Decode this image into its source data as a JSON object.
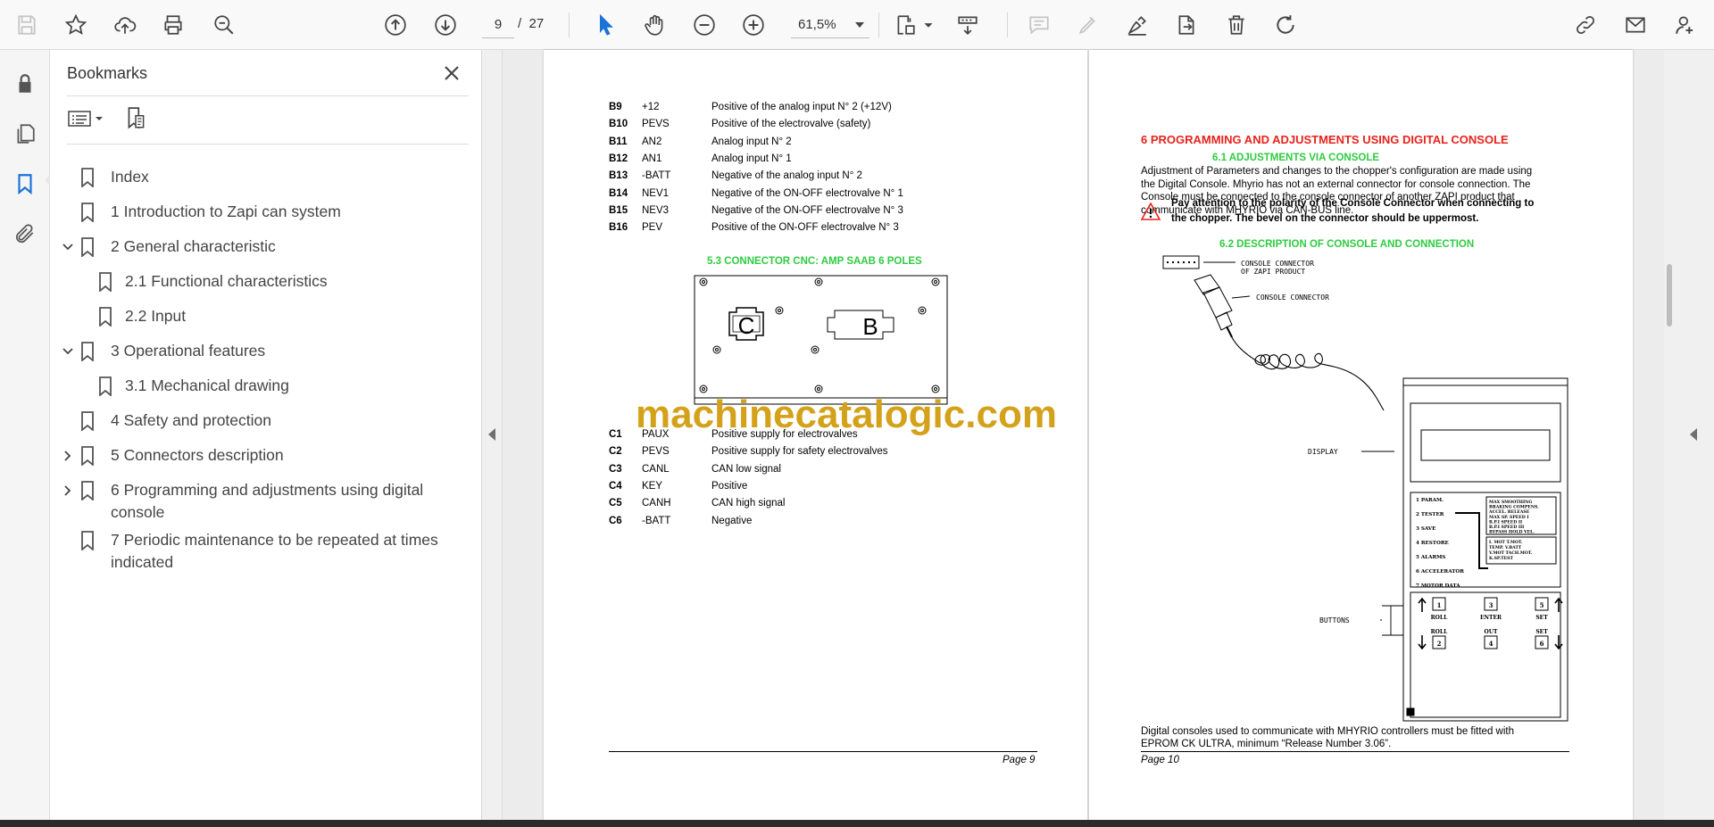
{
  "toolbar": {
    "page_current": "9",
    "page_separator": "/",
    "page_total": "27",
    "zoom": "61,5%",
    "icons": [
      "save-icon",
      "star-icon",
      "cloud-upload-icon",
      "print-icon",
      "zoom-search-icon",
      "page-up-icon",
      "page-down-icon",
      "select-cursor-icon",
      "hand-icon",
      "zoom-out-icon",
      "zoom-in-icon",
      "fit-page-icon",
      "scroll-mode-icon",
      "comment-icon",
      "highlight-icon",
      "sign-icon",
      "export-icon",
      "delete-icon",
      "rotate-icon",
      "share-link-icon",
      "email-icon",
      "add-user-icon"
    ]
  },
  "rail": {
    "icons": [
      "lock-icon",
      "pages-icon",
      "bookmark-icon",
      "attachment-icon"
    ]
  },
  "bookmarks": {
    "title": "Bookmarks",
    "items": [
      {
        "label": "Index"
      },
      {
        "label": "1 Introduction to Zapi can system"
      },
      {
        "label": "2 General characteristic"
      },
      {
        "label": "2.1 Functional characteristics"
      },
      {
        "label": "2.2 Input"
      },
      {
        "label": "3 Operational features"
      },
      {
        "label": "3.1 Mechanical drawing"
      },
      {
        "label": "4 Safety and protection"
      },
      {
        "label": "5 Connectors description"
      },
      {
        "label": "6 Programming and adjustments using digital",
        "label2": "console"
      },
      {
        "label": "7 Periodic maintenance to be repeated at times",
        "label2": "indicated"
      }
    ]
  },
  "page9": {
    "rows_b": [
      {
        "pin": "B9",
        "sig": "+12",
        "desc": "Positive of the analog input N° 2 (+12V)"
      },
      {
        "pin": "B10",
        "sig": "PEVS",
        "desc": "Positive of the electrovalve (safety)"
      },
      {
        "pin": "B11",
        "sig": "AN2",
        "desc": "Analog input N° 2"
      },
      {
        "pin": "B12",
        "sig": "AN1",
        "desc": "Analog input N° 1"
      },
      {
        "pin": "B13",
        "sig": "-BATT",
        "desc": "Negative of the analog input N° 2"
      },
      {
        "pin": "B14",
        "sig": "NEV1",
        "desc": "Negative of the ON-OFF electrovalve N° 1"
      },
      {
        "pin": "B15",
        "sig": "NEV3",
        "desc": "Negative of the ON-OFF electrovalve N° 3"
      },
      {
        "pin": "B16",
        "sig": "PEV",
        "desc": "Positive of the ON-OFF electrovalve N° 3"
      }
    ],
    "section_title": "5.3 CONNECTOR CNC: AMP SAAB 6 POLES",
    "connector_c": "C",
    "connector_b": "B",
    "rows_c": [
      {
        "pin": "C1",
        "sig": "PAUX",
        "desc": "Positive supply for electrovalves"
      },
      {
        "pin": "C2",
        "sig": "PEVS",
        "desc": "Positive supply for safety electrovalves"
      },
      {
        "pin": "C3",
        "sig": "CANL",
        "desc": "CAN low signal"
      },
      {
        "pin": "C4",
        "sig": "KEY",
        "desc": "Positive"
      },
      {
        "pin": "C5",
        "sig": "CANH",
        "desc": "CAN high signal"
      },
      {
        "pin": "C6",
        "sig": "-BATT",
        "desc": "Negative"
      }
    ],
    "footer": "Page 9"
  },
  "page10": {
    "heading": "6 PROGRAMMING AND ADJUSTMENTS USING DIGITAL CONSOLE",
    "sub1": "6.1 ADJUSTMENTS VIA CONSOLE",
    "para": [
      "Adjustment of Parameters and changes to the chopper's configuration are made using",
      "the Digital Console. Mhyrio has not an external connector for console connection. The",
      "Console must be connected to the console connector of another ZAPI product that",
      "communicate with MHYRIO via CAN-BUS line."
    ],
    "warning": [
      "Pay attention to the polarity of the Console Connector when connecting to",
      "the chopper. The bevel on the connector should be uppermost."
    ],
    "sub2": "6.2 DESCRIPTION OF CONSOLE AND CONNECTION",
    "labels": {
      "console_connector_of": "CONSOLE CONNECTOR",
      "of_zapi": "OF ZAPI PRODUCT",
      "console_connector": "CONSOLE CONNECTOR",
      "display": "DISPLAY",
      "buttons": "BUTTONS"
    },
    "menu": [
      "1 PARAM.",
      "2 TESTER",
      "3 SAVE",
      "4 RESTORE",
      "5 ALARMS",
      "6 ACCELERATOR",
      "7 MOTOR DATA"
    ],
    "menu_right": [
      "MAX  SMOOTHING",
      "BRAKING  COMPENS.",
      "ACCEL.  RELEASE",
      "MAX SP.  SPEED I",
      "R.P.I  SPEED II",
      "B.P.I  SPEED III",
      "BYPASS  HOLD VEL."
    ],
    "menu_right2": [
      "I. MOT  T.MOT.",
      "TEMP.  V.BATT",
      "V.MOT  TACH.MOT.",
      "K.SP.TEST"
    ],
    "keys": [
      "1",
      "3",
      "5",
      "2",
      "4",
      "6"
    ],
    "key_labels": [
      "ROLL",
      "ENTER",
      "SET",
      "ROLL",
      "OUT",
      "SET"
    ],
    "bottom_text": [
      "Digital consoles used to communicate with MHYRIO controllers must be fitted with",
      "EPROM CK ULTRA, minimum “Release Number 3.06”."
    ],
    "footer": "Page 10"
  },
  "watermark": "machinecatalogic.com"
}
